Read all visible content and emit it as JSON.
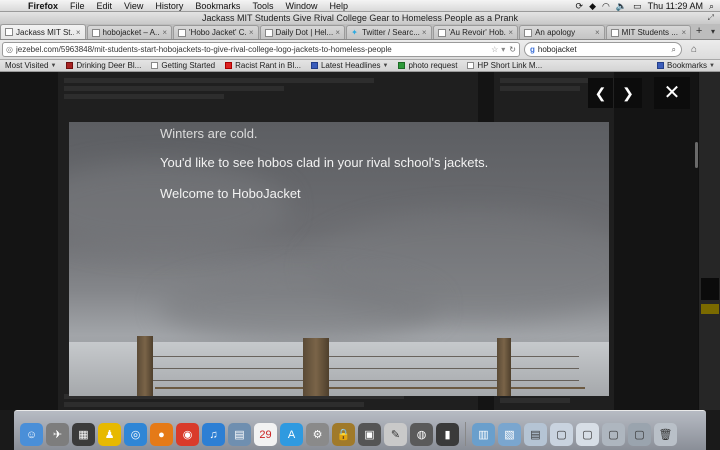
{
  "menubar": {
    "app": "Firefox",
    "items": [
      "File",
      "Edit",
      "View",
      "History",
      "Bookmarks",
      "Tools",
      "Window",
      "Help"
    ],
    "clock": "Thu 11:29 AM"
  },
  "window": {
    "title": "Jackass MIT Students Give Rival College Gear to Homeless People as a Prank"
  },
  "tabs": [
    {
      "label": "Jackass MIT St...",
      "active": true
    },
    {
      "label": "hobojacket – A...",
      "active": false
    },
    {
      "label": "'Hobo Jacket' C...",
      "active": false
    },
    {
      "label": "Daily Dot | Hel...",
      "active": false
    },
    {
      "label": "Twitter / Searc...",
      "active": false
    },
    {
      "label": "'Au Revoir' Hob...",
      "active": false
    },
    {
      "label": "An apology",
      "active": false
    },
    {
      "label": "MIT Students ...",
      "active": false
    }
  ],
  "navbar": {
    "url": "jezebel.com/5963848/mit-students-start-hobojackets-to-give-rival-college-logo-jackets-to-homeless-people",
    "search_value": "hobojacket"
  },
  "bookmarks": [
    {
      "label": "Most Visited",
      "caret": true,
      "icon": "none"
    },
    {
      "label": "Drinking Deer Bl...",
      "caret": false,
      "icon": "red"
    },
    {
      "label": "Getting Started",
      "caret": false,
      "icon": "doc"
    },
    {
      "label": "Racist Rant in Bl...",
      "caret": false,
      "icon": "yt"
    },
    {
      "label": "Latest Headlines",
      "caret": true,
      "icon": "rss"
    },
    {
      "label": "photo request",
      "caret": false,
      "icon": "green"
    },
    {
      "label": "HP Short Link M...",
      "caret": false,
      "icon": "doc"
    }
  ],
  "bookmarks_menu": "Bookmarks",
  "lightbox": {
    "line1": "Winters are cold.",
    "line2": "You'd like to see hobos clad in your rival school's jackets.",
    "line3": "Welcome to HoboJacket"
  },
  "colors": {
    "overlay": "#141414",
    "caption": "#f2f2f2"
  }
}
